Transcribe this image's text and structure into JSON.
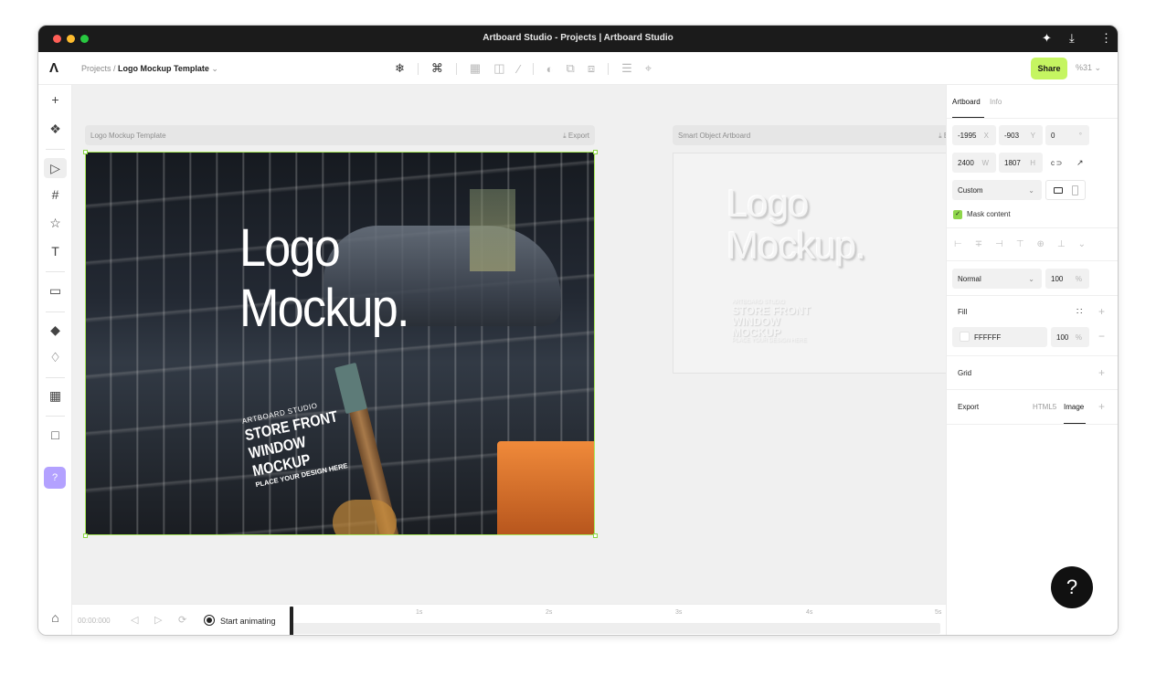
{
  "window": {
    "title": "Artboard Studio - Projects | Artboard Studio"
  },
  "toolbar": {
    "logo": "Λ",
    "breadcrumb_root": "Projects /",
    "breadcrumb_current": "Logo Mockup Template",
    "breadcrumb_chevron": "⌄",
    "share_label": "Share",
    "zoom_label": "%31",
    "zoom_chevron": "⌄",
    "tools": [
      "❄",
      "⌘",
      "▦",
      "◫",
      "⁄",
      "◐",
      "⧉",
      "⧈",
      "☰",
      "⌖"
    ]
  },
  "titlebar_icons": {
    "extension": "✦",
    "download": "⤓",
    "more": "⋮"
  },
  "leftbar": {
    "tools": [
      "+",
      "❖",
      "▷",
      "#",
      "☆",
      "T",
      "▭",
      "◆",
      "♢",
      "▦",
      "□"
    ],
    "help": "?",
    "bottom": "⌂"
  },
  "artboards": [
    {
      "name": "Logo Mockup Template",
      "export": "⤓ Export"
    },
    {
      "name": "Smart Object Artboard",
      "export": "⤓ Export"
    }
  ],
  "mockup": {
    "headline_1": "Logo",
    "headline_2": "Mockup.",
    "studio": "ARTBOARD STUDIO",
    "line_1": "STORE FRONT",
    "line_2": "WINDOW",
    "line_3": "MOCKUP",
    "place": "PLACE YOUR DESIGN HERE"
  },
  "timeline": {
    "time": "00:00:000",
    "controls": [
      "◁",
      "▷",
      "⟳"
    ],
    "start_label": "Start animating",
    "ticks": [
      "1s",
      "2s",
      "3s",
      "4s",
      "5s"
    ]
  },
  "panel": {
    "tab_artboard": "Artboard",
    "tab_info": "Info",
    "x_value": "-1995",
    "x_unit": "X",
    "y_value": "-903",
    "y_unit": "Y",
    "r_value": "0",
    "r_unit": "°",
    "w_value": "2400",
    "w_unit": "W",
    "h_value": "1807",
    "h_unit": "H",
    "link_icon": "c ⊃",
    "expand_icon": "↗",
    "preset": "Custom",
    "preset_chevron": "⌄",
    "mask_label": "Mask content",
    "mask_check": "✓",
    "blend": "Normal",
    "blend_chevron": "⌄",
    "opacity_value": "100",
    "opacity_unit": "%",
    "align_icons": [
      "⊢",
      "∓",
      "⊣",
      "⊤",
      "⊕",
      "⊥",
      "⌄"
    ],
    "fill_label": "Fill",
    "fill_dots": "∷",
    "fill_plus": "+",
    "fill_hex": "FFFFFF",
    "fill_opacity": "100",
    "fill_unit": "%",
    "fill_minus": "−",
    "grid_label": "Grid",
    "grid_plus": "+",
    "export_label": "Export",
    "export_html": "HTML5",
    "export_image": "Image",
    "export_plus": "+",
    "help": "?"
  },
  "colors": {
    "accent": "#c5f561",
    "selection": "#a8e85a",
    "help": "#b3a1ff"
  }
}
